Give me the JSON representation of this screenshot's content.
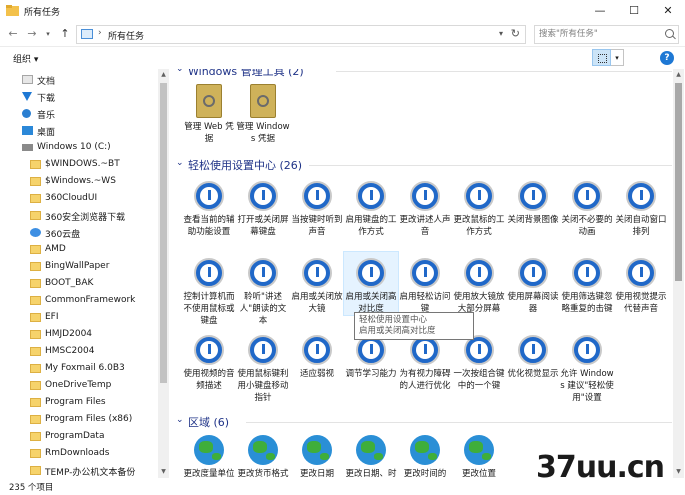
{
  "window": {
    "title": "所有任务",
    "minimize": "—",
    "maximize": "☐",
    "close": "✕"
  },
  "address": {
    "back": "←",
    "forward": "→",
    "up": "↑",
    "path": "所有任务",
    "search_placeholder": "搜索\"所有任务\""
  },
  "toolbar": {
    "organize": "组织 ▾",
    "help": "?"
  },
  "nav": {
    "items": [
      {
        "label": "文档",
        "icon": "documents-icon"
      },
      {
        "label": "下载",
        "icon": "download-icon"
      },
      {
        "label": "音乐",
        "icon": "music-icon"
      },
      {
        "label": "桌面",
        "icon": "desktop-icon"
      },
      {
        "label": "Windows 10 (C:)",
        "icon": "drive-icon"
      },
      {
        "label": "$WINDOWS.~BT",
        "icon": "folder-icon"
      },
      {
        "label": "$Windows.~WS",
        "icon": "folder-icon"
      },
      {
        "label": "360CloudUI",
        "icon": "folder-icon"
      },
      {
        "label": "360安全浏览器下载",
        "icon": "folder-icon"
      },
      {
        "label": "360云盘",
        "icon": "cloud-icon"
      },
      {
        "label": "AMD",
        "icon": "folder-icon"
      },
      {
        "label": "BingWallPaper",
        "icon": "folder-icon"
      },
      {
        "label": "BOOT_BAK",
        "icon": "folder-icon"
      },
      {
        "label": "CommonFramework",
        "icon": "folder-icon"
      },
      {
        "label": "EFI",
        "icon": "folder-icon"
      },
      {
        "label": "HMJD2004",
        "icon": "folder-icon"
      },
      {
        "label": "HMSC2004",
        "icon": "folder-icon"
      },
      {
        "label": "My Foxmail 6.0B3",
        "icon": "folder-icon"
      },
      {
        "label": "OneDriveTemp",
        "icon": "folder-icon"
      },
      {
        "label": "Program Files",
        "icon": "folder-icon"
      },
      {
        "label": "Program Files (x86)",
        "icon": "folder-icon"
      },
      {
        "label": "ProgramData",
        "icon": "folder-icon"
      },
      {
        "label": "RmDownloads",
        "icon": "folder-icon"
      },
      {
        "label": "TEMP-办公机文本备份",
        "icon": "folder-icon"
      }
    ]
  },
  "groups": [
    {
      "title": "Windows 管理工具 (2)",
      "items": [
        "管理 Web 凭据",
        "管理 Windows 凭据"
      ]
    },
    {
      "title": "轻松使用设置中心 (26)",
      "items": [
        "查看当前的辅助功能设置",
        "打开或关闭屏幕键盘",
        "当按键时听到声音",
        "启用键盘的工作方式",
        "更改讲述人声音",
        "更改鼠标的工作方式",
        "关闭背景图像",
        "关闭不必要的动画",
        "关闭自动窗口排列",
        "控制计算机而不使用鼠标或键盘",
        "聆听\"讲述人\"朗读的文本",
        "启用或关闭放大镜",
        "启用或关闭高对比度",
        "启用轻松访问键",
        "使用放大镜放大部分屏幕",
        "使用屏幕阅读器",
        "使用筛选键忽略重复的击键",
        "使用视觉提示代替声音",
        "使用视频的音频描述",
        "使用鼠标键利用小键盘移动指针",
        "适应弱视",
        "调节学习能力",
        "为有视力障碍的人进行优化",
        "一次按组合键中的一个键",
        "优化视觉显示",
        "允许 Windows 建议\"轻松使用\"设置"
      ]
    },
    {
      "title": "区域 (6)",
      "items": [
        "更改度量单位",
        "更改货币格式",
        "更改日期",
        "更改日期、时间",
        "更改时间的",
        "更改位置"
      ]
    }
  ],
  "tooltip": {
    "line1": "轻松使用设置中心",
    "line2": "启用或关闭高对比度"
  },
  "status": {
    "count": "235 个项目"
  },
  "watermark": "37uu.cn"
}
